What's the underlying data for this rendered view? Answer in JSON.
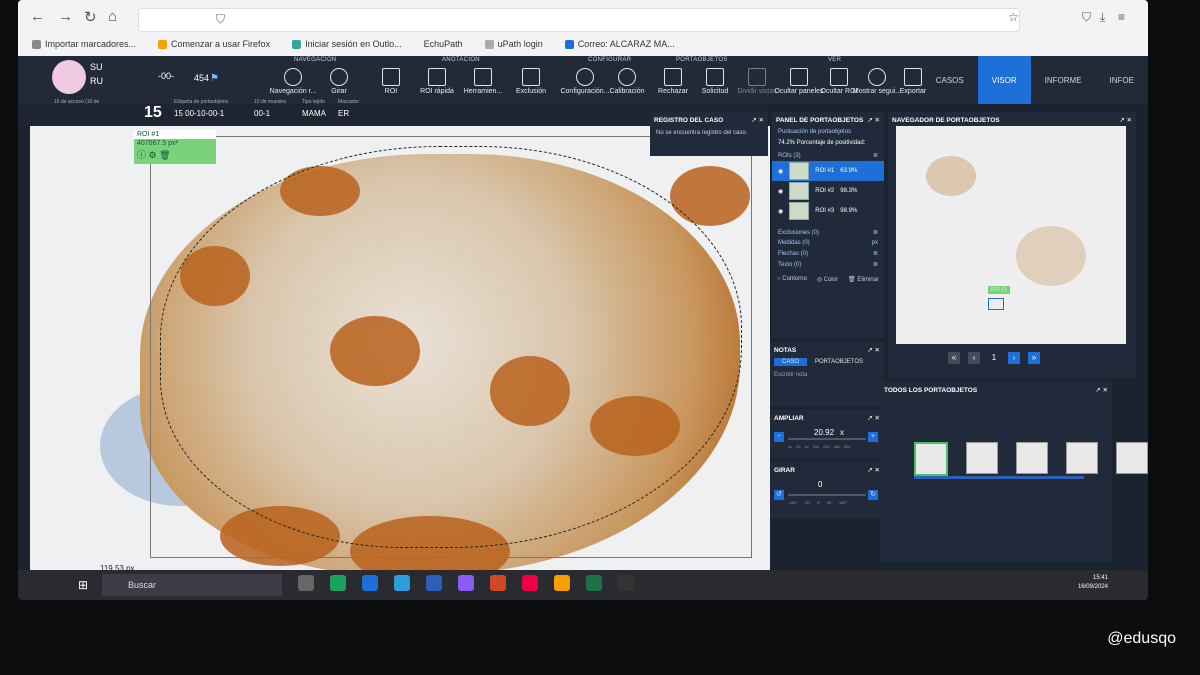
{
  "browser": {
    "bookmarks": [
      "Importar marcadores...",
      "Comenzar a usar Firefox",
      "Iniciar sesión en Outlo...",
      "EchuPath",
      "uPath login",
      "Correo: ALCARAZ MA..."
    ]
  },
  "case": {
    "line1": "SU",
    "line2": "RU",
    "id_fragment": "-00-",
    "number": "454",
    "day": "15",
    "info_labels": [
      "16 de acceso (10 de",
      "Etiqueta de portaobjetos",
      "10 de muestra",
      "Tipo tejido",
      "Marcador"
    ],
    "slide_label": "15 00-10-00-1",
    "sample": "00-1",
    "tissue": "MAMA",
    "marker": "ER"
  },
  "toolbar": {
    "groups": [
      "NAVEGACIÓN",
      "ANOTACIÓN",
      "CONFIGURAR",
      "PORTAOBJETOS",
      "VER"
    ],
    "tools": [
      "Navegación r...",
      "Girar",
      "ROI",
      "ROI rápida",
      "Herramien...",
      "Exclusión",
      "Configuración...",
      "Calibración",
      "Rechazar",
      "Solicitud",
      "Dividir vistas",
      "Ocultar paneles",
      "Ocultar ROI",
      "Mostrar segui...",
      "Exportar"
    ],
    "tabs": [
      "CASOS",
      "VISOR",
      "INFORME",
      "INFOE"
    ]
  },
  "viewer": {
    "roi_label": "ROI #1",
    "roi_area": "407067.5 px²",
    "scale_label": "119.53 px"
  },
  "registro": {
    "title": "REGISTRO DEL CASO",
    "message": "No se encuentra registro del caso."
  },
  "panel_porta": {
    "title": "PANEL DE PORTAOBJETOS",
    "puntuacion": "Puntuación de portaobjetos",
    "positividad": "74.2% Porcentaje de positividad:",
    "rois_title": "ROIs (3)",
    "rois": [
      {
        "name": "ROI #1",
        "value": "63.9%"
      },
      {
        "name": "ROI #2",
        "value": "98.3%"
      },
      {
        "name": "ROI #3",
        "value": "98.9%"
      }
    ],
    "sections": [
      "Exclusiones (0)",
      "Medidas (0)",
      "Flechas (0)",
      "Texto (0)"
    ],
    "unit": "px",
    "bottom": [
      "Contorno",
      "Color",
      "Eliminar"
    ]
  },
  "notas": {
    "title": "NOTAS",
    "tabs": [
      "CASO",
      "PORTAOBJETOS"
    ],
    "placeholder": "Escribir nota"
  },
  "ampliar": {
    "title": "AMPLIAR",
    "value": "20.92",
    "unit": "x",
    "steps": [
      "1x",
      "2x",
      "4x",
      "10x",
      "20x",
      "40x",
      "80x"
    ]
  },
  "girar": {
    "title": "GIRAR",
    "value": "0",
    "marks": [
      "-180°",
      "-90°",
      "0°",
      "90°",
      "180°"
    ]
  },
  "navegador": {
    "title": "NAVEGADOR DE PORTAOBJETOS",
    "roi_tag": "ROI #1",
    "page": "1"
  },
  "todos": {
    "title": "TODOS LOS PORTAOBJETOS"
  },
  "taskbar": {
    "search": "Buscar",
    "time": "15:41",
    "date": "16/09/2024"
  },
  "watermark": "@edusqo",
  "colors": {
    "accent": "#1f6fd8",
    "panel": "#212a3a",
    "roi_green": "#7ad27a",
    "stain": "#b8611c"
  }
}
